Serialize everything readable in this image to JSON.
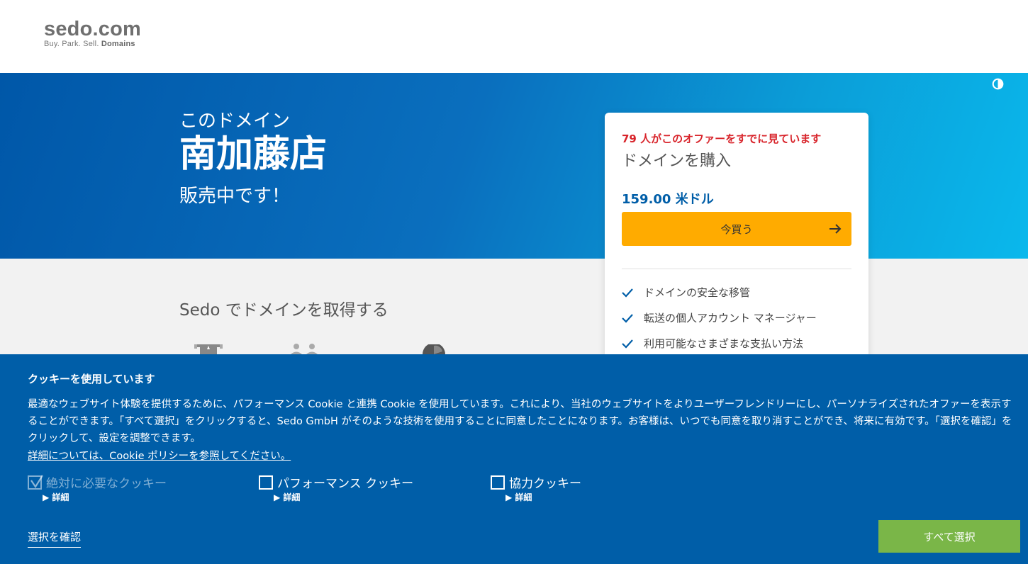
{
  "header": {
    "logo_main": "sedo.com",
    "logo_tag_plain": "Buy.  Park.  Sell. ",
    "logo_tag_bold": "Domains"
  },
  "hero": {
    "pre": "このドメイン",
    "domain_name": "南加藤店",
    "post": "販売中です！"
  },
  "purchase_card": {
    "viewers_text": "79 人がこのオファーをすでに見ています",
    "title": "ドメインを購入",
    "price": "159.00 米ドル",
    "buy_button_label": "今買う",
    "features": [
      "ドメインの安全な移管",
      "転送の個人アカウント マネージャー",
      "利用可能なさまざまな支払い方法"
    ]
  },
  "sedo_section": {
    "heading": "Sedo でドメインを取得する"
  },
  "cookie_banner": {
    "title": "クッキーを使用しています",
    "text": "最適なウェブサイト体験を提供するために、パフォーマンス Cookie と連携 Cookie を使用しています。これにより、当社のウェブサイトをよりユーザーフレンドリーにし、パーソナライズされたオファーを表示することができます。「すべて選択」をクリックすると、Sedo GmbH がそのような技術を使用することに同意したことになります。お客様は、いつでも同意を取り消すことができ、将来に有効です。「選択を確認」をクリックして、設定を調整できます。",
    "policy_link": "詳細については、Cookie ポリシーを参照してください。",
    "options": [
      {
        "label": "絶対に必要なクッキー",
        "checked": true,
        "disabled": true,
        "detail": "詳細"
      },
      {
        "label": "パフォーマンス クッキー",
        "checked": false,
        "disabled": false,
        "detail": "詳細"
      },
      {
        "label": "協力クッキー",
        "checked": false,
        "disabled": false,
        "detail": "詳細"
      }
    ],
    "confirm_label": "選択を確認",
    "select_all_label": "すべて選択"
  },
  "colors": {
    "brand_blue": "#005ea8",
    "buy_button": "#ffab00",
    "viewers_red": "#d8232a",
    "select_all_green": "#7ab648"
  }
}
